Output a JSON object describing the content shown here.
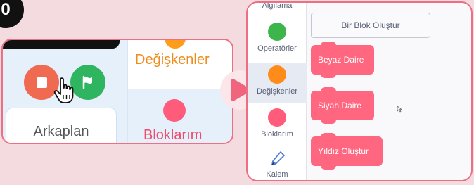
{
  "step_badge": "0",
  "left_panel": {
    "stop_button": "stop",
    "green_flag_button": "green-flag",
    "backdrop_label": "Arkaplan",
    "variables_label": "Değişkenler",
    "my_blocks_label": "Bloklarım",
    "colors": {
      "stop": "#ef6a50",
      "go": "#2fb560",
      "variables": "#ff9c1a",
      "my_blocks": "#ff5b7a"
    }
  },
  "right_panel": {
    "categories": [
      {
        "label": "Algılama"
      },
      {
        "label": "Operatörler",
        "color": "#3cb54a"
      },
      {
        "label": "Değişkenler",
        "color": "#ff8c1a",
        "selected": true
      },
      {
        "label": "Bloklarım",
        "color": "#ff5b7a"
      },
      {
        "label": "Kalem",
        "icon": "pen-icon"
      }
    ],
    "make_block_label": "Bir Blok Oluştur",
    "blocks": [
      {
        "label": "Beyaz Daire"
      },
      {
        "label": "Siyah Daire"
      },
      {
        "label": "Yıldız Oluştur"
      }
    ],
    "block_color": "#ff6680"
  },
  "arrow_color": "#f0657d"
}
